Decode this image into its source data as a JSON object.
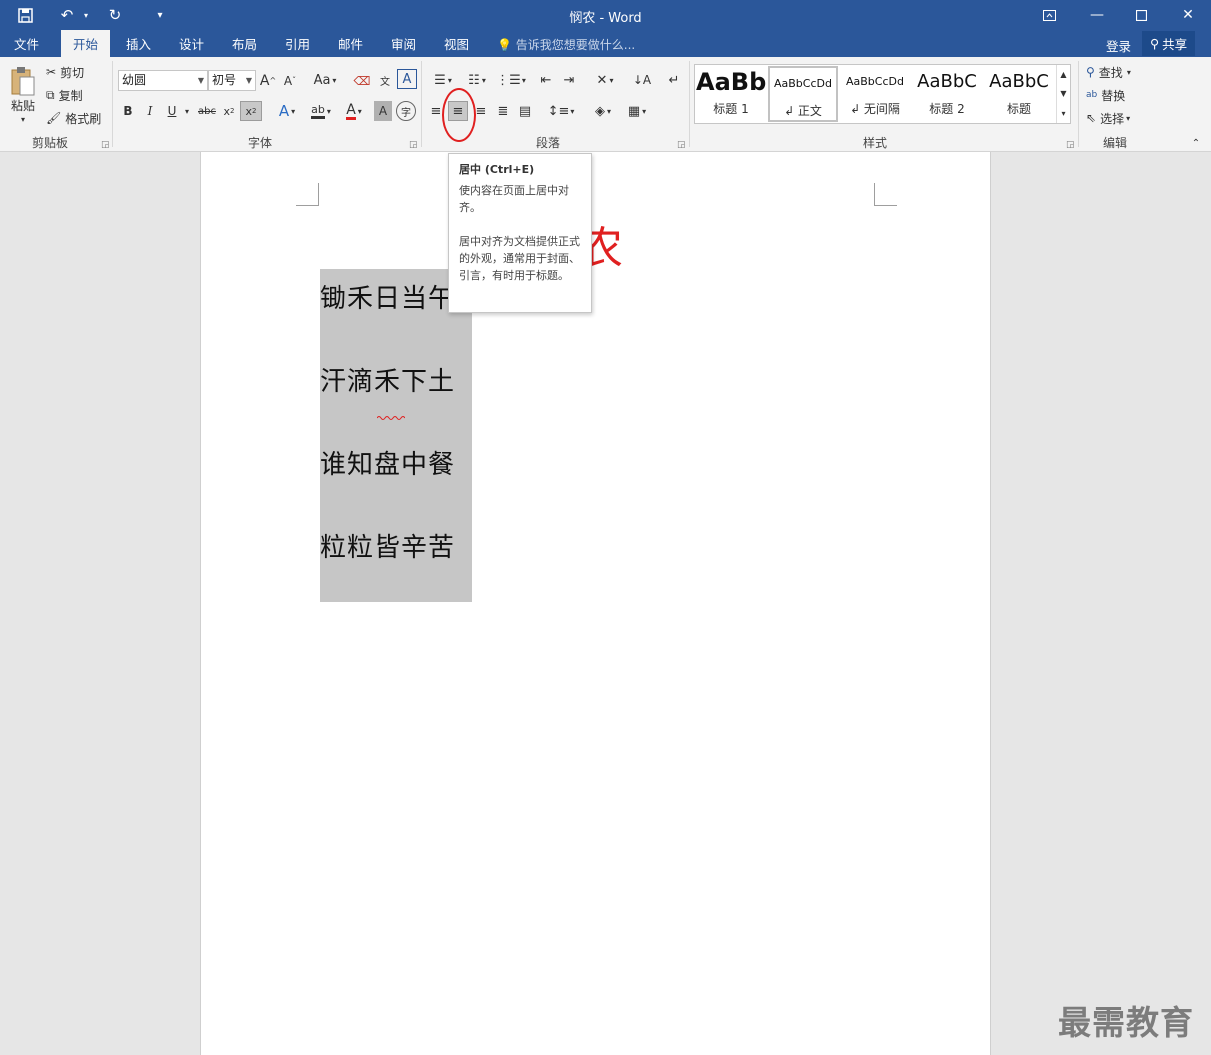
{
  "app": {
    "window_title": "悯农 - Word",
    "brand_color": "#2b579a"
  },
  "qat": {
    "save_icon": "save-icon",
    "undo_icon": "undo-icon",
    "redo_icon": "redo-icon",
    "customize_icon": "customize-qat-icon"
  },
  "tabs": [
    "文件",
    "开始",
    "插入",
    "设计",
    "布局",
    "引用",
    "邮件",
    "审阅",
    "视图"
  ],
  "active_tab": "开始",
  "tell_me": "告诉我您想要做什么...",
  "account": {
    "login": "登录",
    "share": "共享"
  },
  "clipboard": {
    "paste": "粘贴",
    "cut": "剪切",
    "copy": "复制",
    "format_painter": "格式刷",
    "label": "剪贴板"
  },
  "font": {
    "name": "幼圆",
    "size": "初号",
    "change_case": "Aa",
    "label": "字体"
  },
  "paragraph": {
    "label": "段落"
  },
  "styles": {
    "label": "样式",
    "items": [
      {
        "preview": "AaBb",
        "name": "标题 1"
      },
      {
        "preview": "AaBbCcDd",
        "name": "↲ 正文"
      },
      {
        "preview": "AaBbCcDd",
        "name": "↲ 无间隔"
      },
      {
        "preview": "AaBbC",
        "name": "标题 2"
      },
      {
        "preview": "AaBbC",
        "name": "标题"
      }
    ]
  },
  "editing": {
    "find": "查找",
    "replace": "替换",
    "select": "选择",
    "label": "编辑"
  },
  "tooltip": {
    "title": "居中 (Ctrl+E)",
    "line1": "使内容在页面上居中对齐。",
    "line2": "居中对齐为文档提供正式的外观，通常用于封面、引言，有时用于标题。"
  },
  "document": {
    "title_visible": "农",
    "lines": [
      "锄禾日当午",
      "汗滴禾下土",
      "谁知盘中餐",
      "粒粒皆辛苦"
    ]
  },
  "watermark": "最需教育"
}
